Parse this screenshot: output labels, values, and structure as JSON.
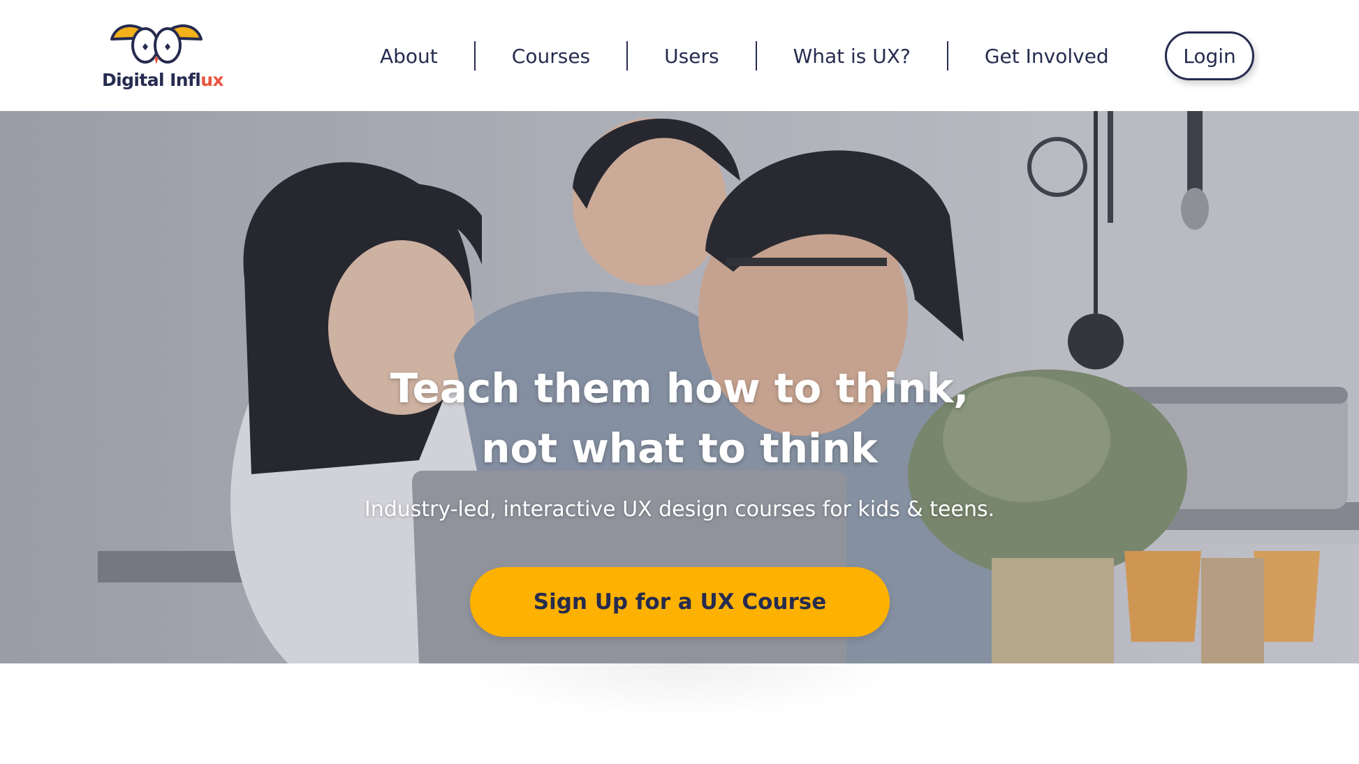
{
  "brand": {
    "name_main": "Digital Infl",
    "name_accent": "ux"
  },
  "nav": {
    "items": [
      {
        "label": "About"
      },
      {
        "label": "Courses"
      },
      {
        "label": "Users"
      },
      {
        "label": "What is UX?"
      },
      {
        "label": "Get Involved"
      }
    ],
    "login_label": "Login"
  },
  "hero": {
    "title_line1": "Teach them how to think,",
    "title_line2": "not what to think",
    "subtitle": "Industry-led, interactive UX design courses for kids & teens.",
    "cta_label": "Sign Up for a UX Course"
  },
  "colors": {
    "navy": "#262b4f",
    "accent_yellow": "#fdb100",
    "accent_orange": "#e8553e",
    "logo_yellow": "#f5b11a"
  },
  "icons": [
    "logo-owl-icon"
  ]
}
